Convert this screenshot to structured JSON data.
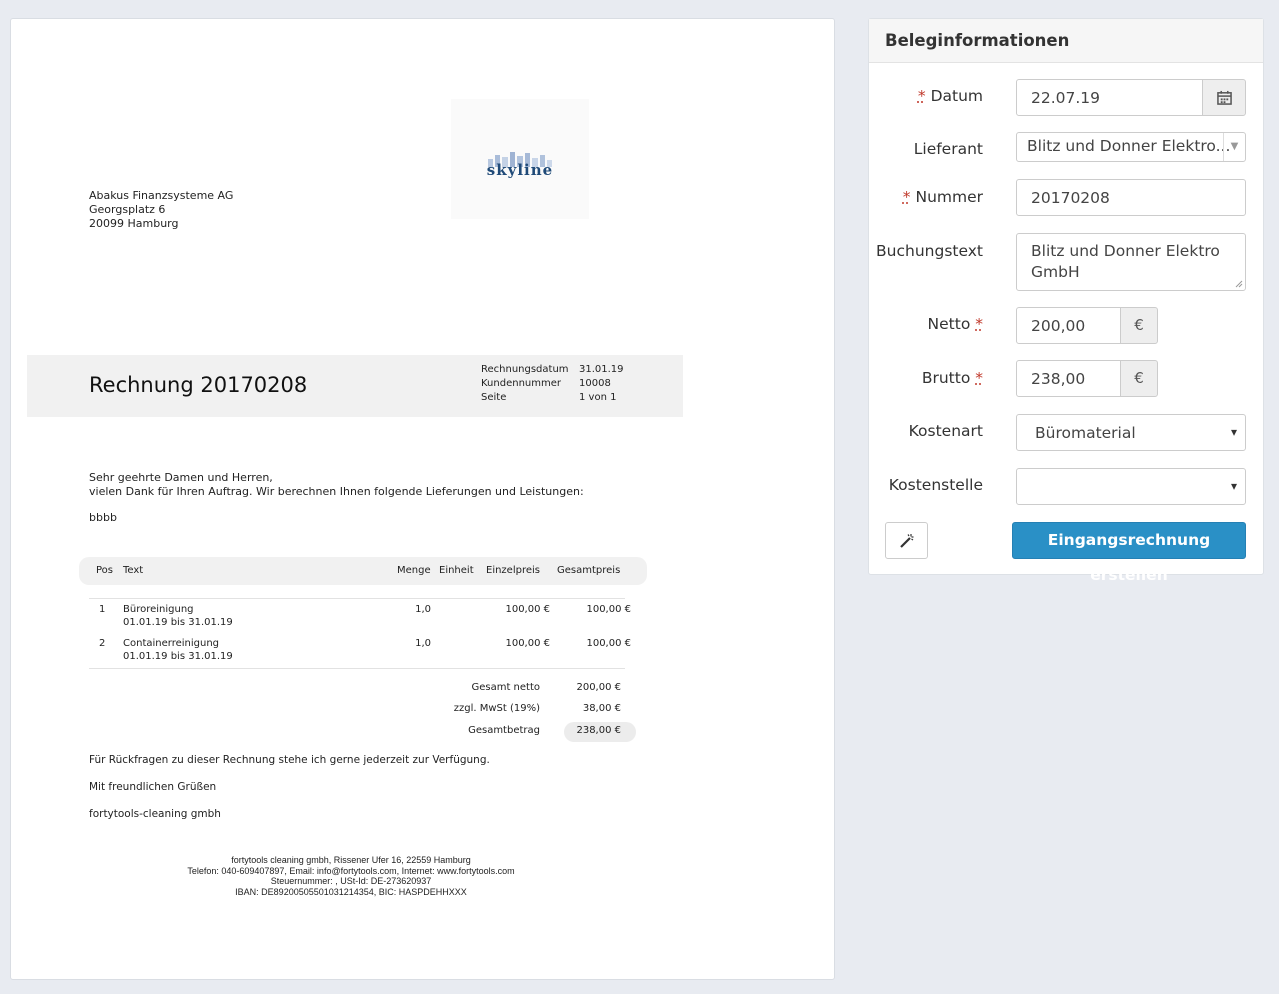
{
  "document": {
    "logo_text": "skyline",
    "sender": [
      "Abakus Finanzsysteme AG",
      "Georgsplatz 6",
      "20099 Hamburg"
    ],
    "invoice_title": "Rechnung 20170208",
    "meta": [
      {
        "label": "Rechnungsdatum",
        "value": "31.01.19"
      },
      {
        "label": "Kundennummer",
        "value": "10008"
      },
      {
        "label": "Seite",
        "value": "1 von 1"
      }
    ],
    "greeting": "Sehr geehrte Damen und Herren,",
    "intro": "vielen Dank für Ihren Auftrag. Wir berechnen Ihnen folgende Lieferungen und Leistungen:",
    "note": "bbbb",
    "table_headers": {
      "pos": "Pos",
      "text": "Text",
      "menge": "Menge",
      "einheit": "Einheit",
      "einzelpreis": "Einzelpreis",
      "gesamtpreis": "Gesamtpreis"
    },
    "items": [
      {
        "pos": "1",
        "text": "Büroreinigung",
        "period": "01.01.19 bis 31.01.19",
        "menge": "1,0",
        "einzelpreis": "100,00 €",
        "gesamtpreis": "100,00 €"
      },
      {
        "pos": "2",
        "text": "Containerreinigung",
        "period": "01.01.19 bis 31.01.19",
        "menge": "1,0",
        "einzelpreis": "100,00 €",
        "gesamtpreis": "100,00 €"
      }
    ],
    "totals": [
      {
        "label": "Gesamt netto",
        "value": "200,00 €"
      },
      {
        "label": "zzgl. MwSt (19%)",
        "value": "38,00 €"
      },
      {
        "label": "Gesamtbetrag",
        "value": "238,00 €"
      }
    ],
    "closing_question": "Für Rückfragen zu dieser Rechnung stehe ich gerne jederzeit zur Verfügung.",
    "closing_regards": "Mit freundlichen Grüßen",
    "closing_company": "fortytools-cleaning gmbh",
    "footer": [
      "fortytools cleaning gmbh, Rissener Ufer 16, 22559  Hamburg",
      "Telefon: 040-609407897, Email: info@fortytools.com, Internet: www.fortytools.com",
      "Steuernummer: , USt-Id: DE-273620937",
      "IBAN: DE89200505501031214354, BIC: HASPDEHHXXX"
    ]
  },
  "panel": {
    "title": "Beleginformationen",
    "required_mark": "*",
    "datum": {
      "label": "Datum",
      "value": "22.07.19"
    },
    "lieferant": {
      "label": "Lieferant",
      "value": "Blitz und Donner Elektro..."
    },
    "nummer": {
      "label": "Nummer",
      "value": "20170208"
    },
    "buchungstext": {
      "label": "Buchungstext",
      "line1": "Blitz und Donner Elektro",
      "line2": "GmbH"
    },
    "netto": {
      "label": "Netto",
      "value": "200,00",
      "unit": "€"
    },
    "brutto": {
      "label": "Brutto",
      "value": "238,00",
      "unit": "€"
    },
    "kostenart": {
      "label": "Kostenart",
      "value": "Büromaterial"
    },
    "kostenstelle": {
      "label": "Kostenstelle",
      "value": ""
    },
    "create_button": "Eingangsrechnung erstellen",
    "icons": {
      "calendar": "calendar-icon",
      "wand": "magic-wand-icon",
      "caret": "chevron-down-icon"
    }
  }
}
